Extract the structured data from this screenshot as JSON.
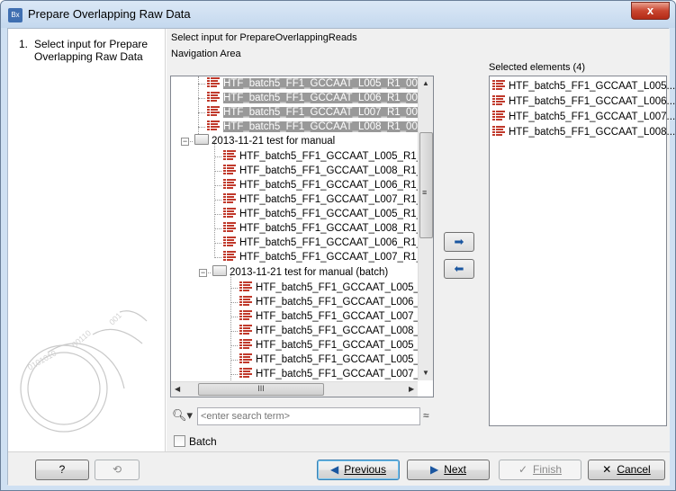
{
  "window": {
    "app_icon_text": "Bx",
    "title": "Prepare Overlapping Raw Data",
    "close_label": "x"
  },
  "steps": [
    {
      "number": "1.",
      "label": "Select input for Prepare Overlapping Raw Data"
    }
  ],
  "content": {
    "header": "Select input for PrepareOverlappingReads",
    "navigation_label": "Navigation Area",
    "selected_label": "Selected elements (4)"
  },
  "tree": {
    "rows": [
      {
        "label": "HTF_batch5_FF1_GCCAAT_L005_R1_001 (p",
        "type": "seq",
        "selected": true
      },
      {
        "label": "HTF_batch5_FF1_GCCAAT_L006_R1_001 (p",
        "type": "seq",
        "selected": true
      },
      {
        "label": "HTF_batch5_FF1_GCCAAT_L007_R1_001 (p",
        "type": "seq",
        "selected": true
      },
      {
        "label": "HTF_batch5_FF1_GCCAAT_L008_R1_001 (p",
        "type": "seq",
        "selected": true
      },
      {
        "label": "2013-11-21 test for manual",
        "type": "folder",
        "selected": false
      },
      {
        "label": "HTF_batch5_FF1_GCCAAT_L005_R1_00",
        "type": "seq",
        "selected": false
      },
      {
        "label": "HTF_batch5_FF1_GCCAAT_L008_R1_00",
        "type": "seq",
        "selected": false
      },
      {
        "label": "HTF_batch5_FF1_GCCAAT_L006_R1_00",
        "type": "seq",
        "selected": false
      },
      {
        "label": "HTF_batch5_FF1_GCCAAT_L007_R1_00",
        "type": "seq",
        "selected": false
      },
      {
        "label": "HTF_batch5_FF1_GCCAAT_L005_R1_00",
        "type": "seq",
        "selected": false
      },
      {
        "label": "HTF_batch5_FF1_GCCAAT_L008_R1_00",
        "type": "seq",
        "selected": false
      },
      {
        "label": "HTF_batch5_FF1_GCCAAT_L006_R1_00",
        "type": "seq",
        "selected": false
      },
      {
        "label": "HTF_batch5_FF1_GCCAAT_L007_R1_00",
        "type": "seq",
        "selected": false
      },
      {
        "label": "2013-11-21 test for manual (batch)",
        "type": "folder",
        "selected": false
      },
      {
        "label": "HTF_batch5_FF1_GCCAAT_L005_R1",
        "type": "seq",
        "selected": false
      },
      {
        "label": "HTF_batch5_FF1_GCCAAT_L006_R1",
        "type": "seq",
        "selected": false
      },
      {
        "label": "HTF_batch5_FF1_GCCAAT_L007_R1",
        "type": "seq",
        "selected": false
      },
      {
        "label": "HTF_batch5_FF1_GCCAAT_L008_R1",
        "type": "seq",
        "selected": false
      },
      {
        "label": "HTF_batch5_FF1_GCCAAT_L005_R1",
        "type": "seq",
        "selected": false
      },
      {
        "label": "HTF_batch5_FF1_GCCAAT_L005_R1",
        "type": "seq",
        "selected": false
      },
      {
        "label": "HTF_batch5_FF1_GCCAAT_L007_R1",
        "type": "seq",
        "selected": false
      }
    ],
    "hscroll_grip": "III"
  },
  "search": {
    "placeholder": "<enter search term>",
    "value": "<enter search term>"
  },
  "batch": {
    "label": "Batch",
    "checked": false
  },
  "selected_elements": [
    "HTF_batch5_FF1_GCCAAT_L005...",
    "HTF_batch5_FF1_GCCAAT_L006...",
    "HTF_batch5_FF1_GCCAAT_L007...",
    "HTF_batch5_FF1_GCCAAT_L008..."
  ],
  "buttons": {
    "help": "?",
    "reset": "⟲",
    "previous": "Previous",
    "next": "Next",
    "finish": "Finish",
    "cancel": "Cancel",
    "add_arrow": "➡",
    "remove_arrow": "⬅"
  },
  "colors": {
    "accent": "#1a56a0",
    "sequence_icon": "#c0392b",
    "selection": "#999999"
  }
}
